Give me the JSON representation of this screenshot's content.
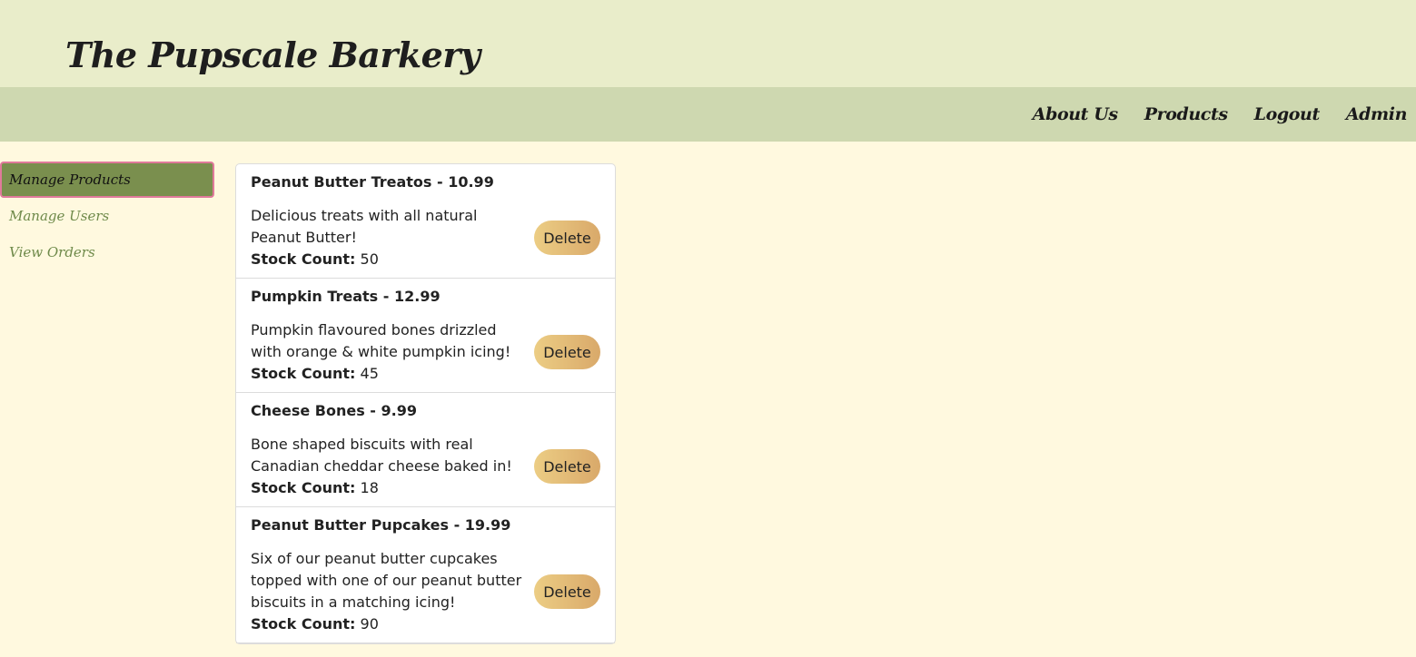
{
  "brand": "The Pupscale Barkery",
  "nav": [
    "About Us",
    "Products",
    "Logout",
    "Admin"
  ],
  "sidebar": {
    "items": [
      {
        "label": "Manage Products",
        "active": true
      },
      {
        "label": "Manage Users",
        "active": false
      },
      {
        "label": "View Orders",
        "active": false
      }
    ]
  },
  "stock_label": "Stock Count:",
  "delete_label": "Delete",
  "products": [
    {
      "title": "Peanut Butter Treatos - 10.99",
      "description": "Delicious treats with all natural Peanut Butter!",
      "stock": "50"
    },
    {
      "title": "Pumpkin Treats - 12.99",
      "description": "Pumpkin flavoured bones drizzled with orange & white pumpkin icing!",
      "stock": "45"
    },
    {
      "title": "Cheese Bones - 9.99",
      "description": "Bone shaped biscuits with real Canadian cheddar cheese baked in!",
      "stock": "18"
    },
    {
      "title": "Peanut Butter Pupcakes - 19.99",
      "description": "Six of our peanut butter cupcakes topped with one of our peanut butter biscuits in a matching icing!",
      "stock": "90"
    }
  ]
}
